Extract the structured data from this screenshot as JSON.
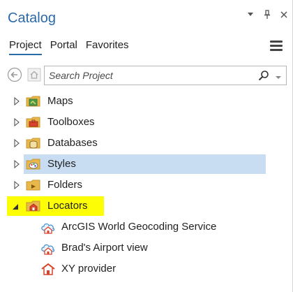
{
  "pane": {
    "title": "Catalog",
    "title_buttons": [
      "chevron-down-icon",
      "pin-icon",
      "close-icon"
    ]
  },
  "tabs": [
    {
      "label": "Project",
      "active": true
    },
    {
      "label": "Portal",
      "active": false
    },
    {
      "label": "Favorites",
      "active": false
    }
  ],
  "search": {
    "placeholder": "Search Project",
    "value": ""
  },
  "tree": {
    "items": [
      {
        "label": "Maps",
        "icon": "maps-folder-icon",
        "expanded": false
      },
      {
        "label": "Toolboxes",
        "icon": "toolboxes-folder-icon",
        "expanded": false
      },
      {
        "label": "Databases",
        "icon": "databases-folder-icon",
        "expanded": false
      },
      {
        "label": "Styles",
        "icon": "styles-folder-icon",
        "expanded": false,
        "selected": true
      },
      {
        "label": "Folders",
        "icon": "folders-folder-icon",
        "expanded": false
      },
      {
        "label": "Locators",
        "icon": "locators-folder-icon",
        "expanded": true,
        "highlighted": true
      }
    ],
    "locators_children": [
      {
        "label": "ArcGIS World Geocoding Service",
        "icon": "world-locator-icon"
      },
      {
        "label": "Brad's Airport view",
        "icon": "world-locator-icon"
      },
      {
        "label": "XY provider",
        "icon": "house-locator-icon"
      }
    ]
  },
  "colors": {
    "title": "#2a6aa8",
    "selection": "#c8ddf2",
    "highlight": "#fdfd06",
    "folder": "#e8b84a"
  }
}
